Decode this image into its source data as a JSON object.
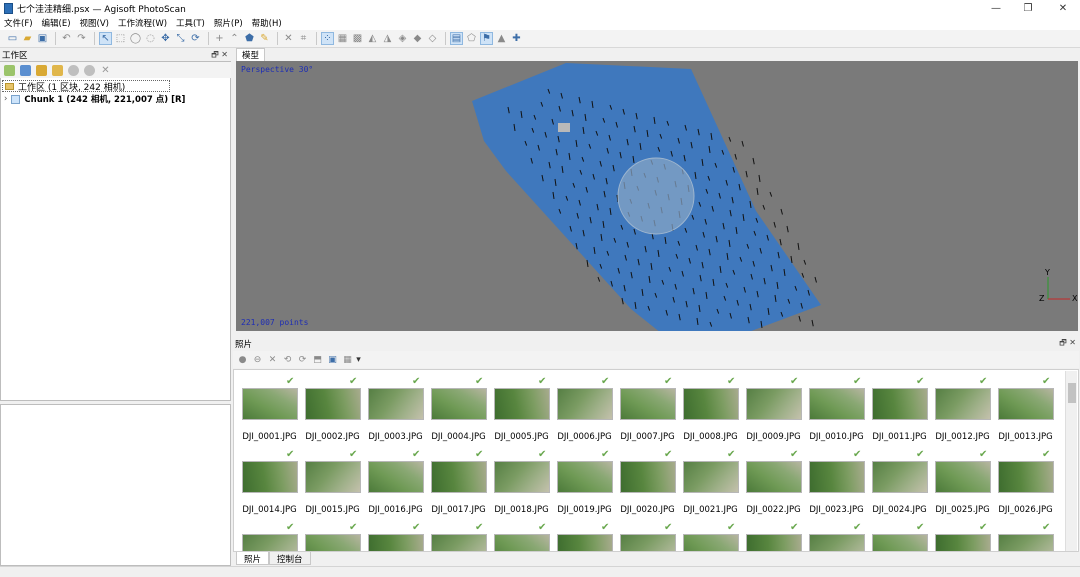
{
  "window": {
    "title": "七个洼洼精细.psx — Agisoft PhotoScan",
    "min_glyph": "—",
    "max_glyph": "❐",
    "close_glyph": "✕"
  },
  "menu": [
    "文件(F)",
    "编辑(E)",
    "视图(V)",
    "工作流程(W)",
    "工具(T)",
    "照片(P)",
    "帮助(H)"
  ],
  "workspace": {
    "header": "工作区",
    "header_controls": "🗗 ✕",
    "root_label": "工作区 (1 区块, 242 相机)",
    "chunk_label": "Chunk 1 (242 相机, 221,007 点) [R]",
    "expand_glyph": "›"
  },
  "model": {
    "tab_label": "模型",
    "view_label": "Perspective 30°",
    "points_label": "221,007 points",
    "axis_labels": {
      "y": "Y",
      "z": "Z",
      "x": "X"
    },
    "cloud_color": "#3f78bd",
    "background_color": "#7a7a7a"
  },
  "photos": {
    "header": "照片",
    "header_controls": "🗗 ✕",
    "items": [
      "DJI_0001.JPG",
      "DJI_0002.JPG",
      "DJI_0003.JPG",
      "DJI_0004.JPG",
      "DJI_0005.JPG",
      "DJI_0006.JPG",
      "DJI_0007.JPG",
      "DJI_0008.JPG",
      "DJI_0009.JPG",
      "DJI_0010.JPG",
      "DJI_0011.JPG",
      "DJI_0012.JPG",
      "DJI_0013.JPG",
      "DJI_0014.JPG",
      "DJI_0015.JPG",
      "DJI_0016.JPG",
      "DJI_0017.JPG",
      "DJI_0018.JPG",
      "DJI_0019.JPG",
      "DJI_0020.JPG",
      "DJI_0021.JPG",
      "DJI_0022.JPG",
      "DJI_0023.JPG",
      "DJI_0024.JPG",
      "DJI_0025.JPG",
      "DJI_0026.JPG",
      "",
      "",
      "",
      "",
      "",
      "",
      "",
      "",
      "",
      "",
      "",
      "",
      ""
    ],
    "check_glyph": "✔",
    "check_color": "#6aa84f"
  },
  "bottom_tabs": [
    "照片",
    "控制台"
  ]
}
